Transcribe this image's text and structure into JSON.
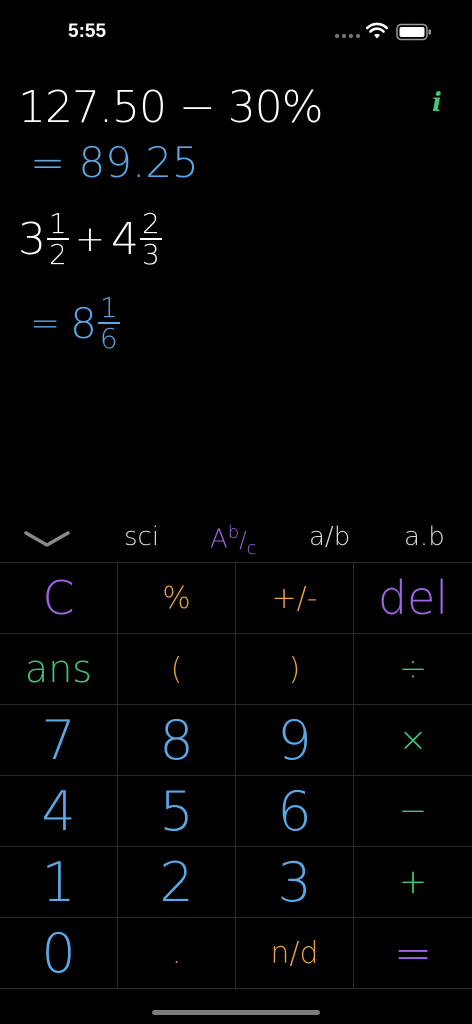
{
  "status_bar": {
    "time": "5:55"
  },
  "display": {
    "line1": "127.50 − 30%",
    "result1": "= 89.25",
    "line2": {
      "whole_a": "3",
      "num_a": "1",
      "den_a": "2",
      "operator": "+",
      "whole_b": "4",
      "num_b": "2",
      "den_b": "3"
    },
    "result2": {
      "prefix": "=",
      "whole": "8",
      "num": "1",
      "den": "6"
    },
    "info_icon": "i"
  },
  "mode_bar": {
    "items": [
      {
        "label": "sci",
        "color": "#dcdcdc"
      },
      {
        "label": "Ab/c",
        "color": "#a264e8"
      },
      {
        "label": "a/b",
        "color": "#dcdcdc"
      },
      {
        "label": "a.b",
        "color": "#dcdcdc"
      }
    ]
  },
  "keys": [
    {
      "label": "C",
      "color": "purple"
    },
    {
      "label": "%",
      "color": "orange"
    },
    {
      "label": "+/-",
      "color": "orange"
    },
    {
      "label": "del",
      "color": "purple"
    },
    {
      "label": "ans",
      "color": "green"
    },
    {
      "label": "(",
      "color": "orange"
    },
    {
      "label": ")",
      "color": "orange"
    },
    {
      "label": "÷",
      "color": "green"
    },
    {
      "label": "7",
      "color": "blue"
    },
    {
      "label": "8",
      "color": "blue"
    },
    {
      "label": "9",
      "color": "blue"
    },
    {
      "label": "×",
      "color": "green"
    },
    {
      "label": "4",
      "color": "blue"
    },
    {
      "label": "5",
      "color": "blue"
    },
    {
      "label": "6",
      "color": "blue"
    },
    {
      "label": "−",
      "color": "green"
    },
    {
      "label": "1",
      "color": "blue"
    },
    {
      "label": "2",
      "color": "blue"
    },
    {
      "label": "3",
      "color": "blue"
    },
    {
      "label": "+",
      "color": "green"
    },
    {
      "label": "0",
      "color": "blue"
    },
    {
      "label": ".",
      "color": "orange"
    },
    {
      "label": "n/d",
      "color": "orange"
    },
    {
      "label": "=",
      "color": "purple"
    }
  ],
  "colors": {
    "purple": "#a264e8",
    "orange": "#e6a23c",
    "green": "#3fc77e",
    "blue": "#5aa9e6",
    "background": "#000000"
  }
}
